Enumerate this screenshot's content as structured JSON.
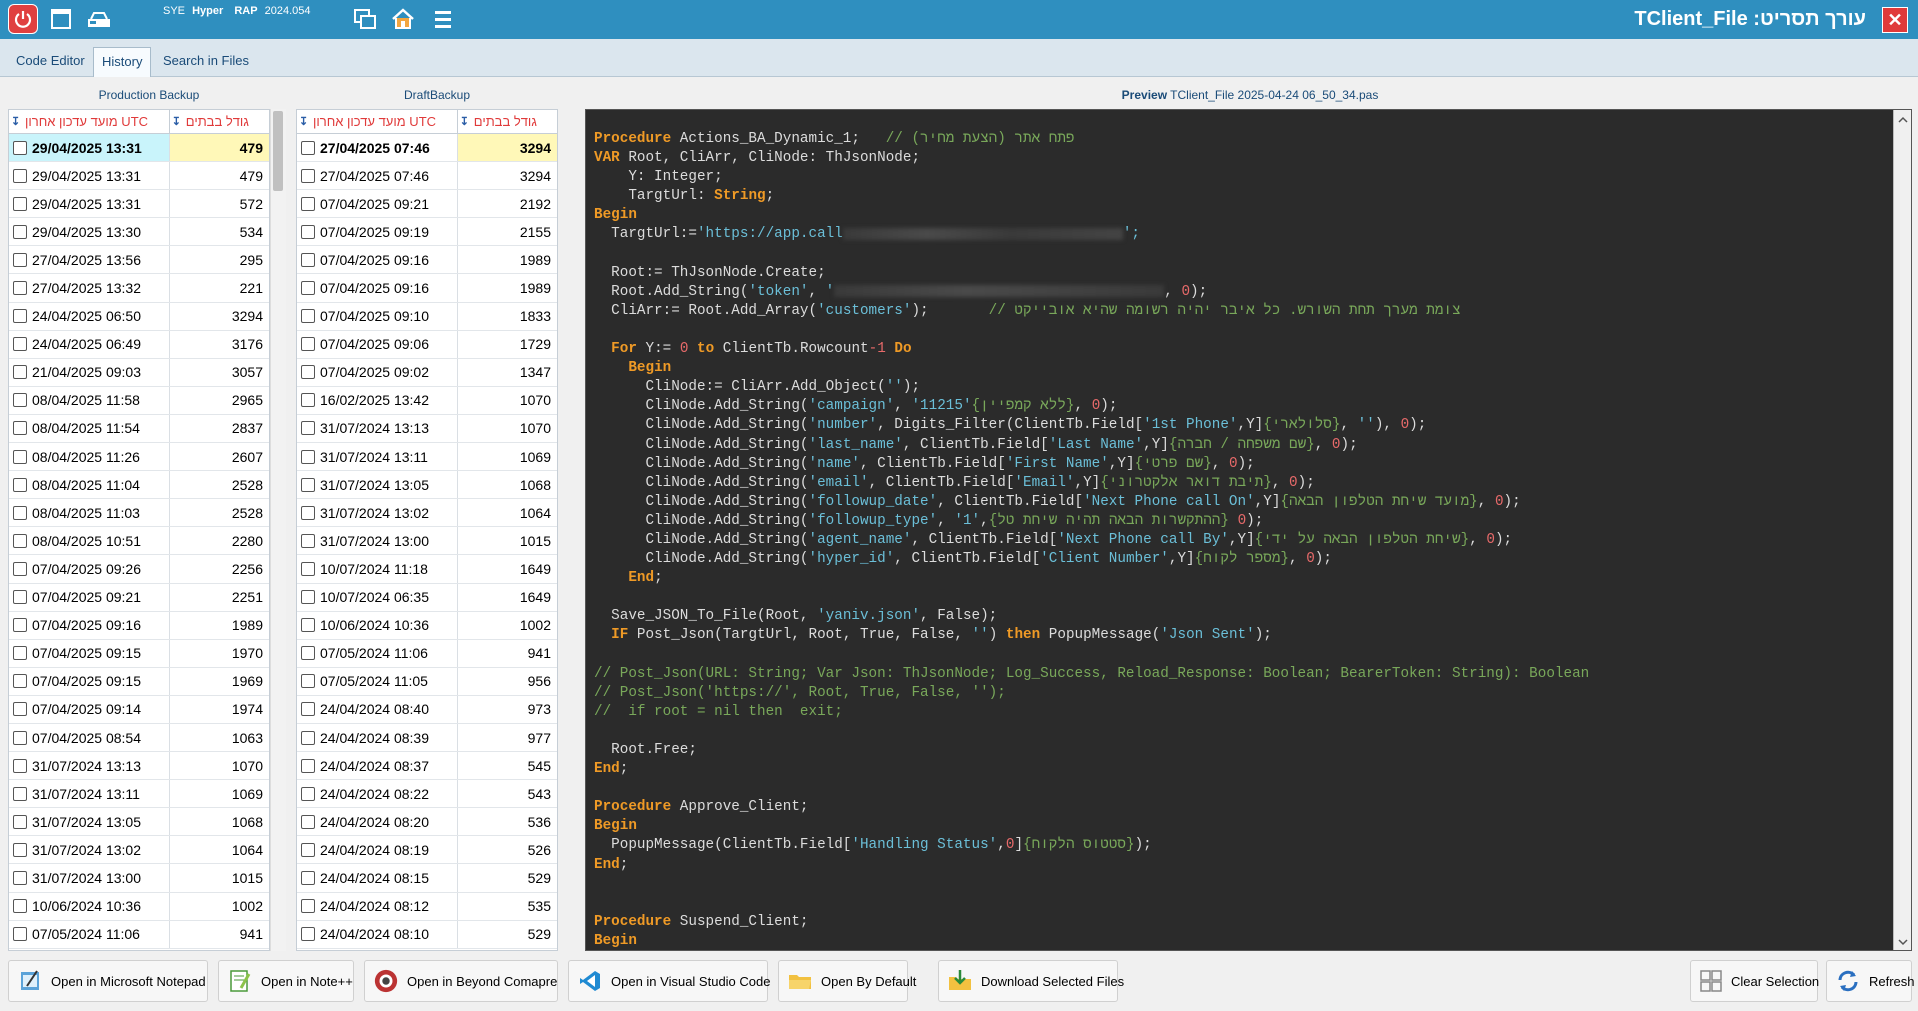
{
  "titlebar": {
    "brand1": "SYE",
    "brand2": "Hyper",
    "brand3": "RAP",
    "version": "2024.054",
    "title": "עורך תסריט: TClient_File",
    "close": "✕"
  },
  "tabs": [
    {
      "label": "Code Editor"
    },
    {
      "label": "History"
    },
    {
      "label": "Search in Files"
    }
  ],
  "production": {
    "header": "Production Backup",
    "col_date": "מועד עדכון אחרון UTC",
    "col_size": "גודל בבתים",
    "rows": [
      {
        "date": "29/04/2025 13:31",
        "size": "479"
      },
      {
        "date": "29/04/2025 13:31",
        "size": "479"
      },
      {
        "date": "29/04/2025 13:31",
        "size": "572"
      },
      {
        "date": "29/04/2025 13:30",
        "size": "534"
      },
      {
        "date": "27/04/2025 13:56",
        "size": "295"
      },
      {
        "date": "27/04/2025 13:32",
        "size": "221"
      },
      {
        "date": "24/04/2025 06:50",
        "size": "3294"
      },
      {
        "date": "24/04/2025 06:49",
        "size": "3176"
      },
      {
        "date": "21/04/2025 09:03",
        "size": "3057"
      },
      {
        "date": "08/04/2025 11:58",
        "size": "2965"
      },
      {
        "date": "08/04/2025 11:54",
        "size": "2837"
      },
      {
        "date": "08/04/2025 11:26",
        "size": "2607"
      },
      {
        "date": "08/04/2025 11:04",
        "size": "2528"
      },
      {
        "date": "08/04/2025 11:03",
        "size": "2528"
      },
      {
        "date": "08/04/2025 10:51",
        "size": "2280"
      },
      {
        "date": "07/04/2025 09:26",
        "size": "2256"
      },
      {
        "date": "07/04/2025 09:21",
        "size": "2251"
      },
      {
        "date": "07/04/2025 09:16",
        "size": "1989"
      },
      {
        "date": "07/04/2025 09:15",
        "size": "1970"
      },
      {
        "date": "07/04/2025 09:15",
        "size": "1969"
      },
      {
        "date": "07/04/2025 09:14",
        "size": "1974"
      },
      {
        "date": "07/04/2025 08:54",
        "size": "1063"
      },
      {
        "date": "31/07/2024 13:13",
        "size": "1070"
      },
      {
        "date": "31/07/2024 13:11",
        "size": "1069"
      },
      {
        "date": "31/07/2024 13:05",
        "size": "1068"
      },
      {
        "date": "31/07/2024 13:02",
        "size": "1064"
      },
      {
        "date": "31/07/2024 13:00",
        "size": "1015"
      },
      {
        "date": "10/06/2024 10:36",
        "size": "1002"
      },
      {
        "date": "07/05/2024 11:06",
        "size": "941"
      }
    ]
  },
  "draft": {
    "header": "DraftBackup",
    "col_date": "מועד עדכון אחרון UTC",
    "col_size": "גודל בבתים",
    "rows": [
      {
        "date": "27/04/2025 07:46",
        "size": "3294"
      },
      {
        "date": "27/04/2025 07:46",
        "size": "3294"
      },
      {
        "date": "07/04/2025 09:21",
        "size": "2192"
      },
      {
        "date": "07/04/2025 09:19",
        "size": "2155"
      },
      {
        "date": "07/04/2025 09:16",
        "size": "1989"
      },
      {
        "date": "07/04/2025 09:16",
        "size": "1989"
      },
      {
        "date": "07/04/2025 09:10",
        "size": "1833"
      },
      {
        "date": "07/04/2025 09:06",
        "size": "1729"
      },
      {
        "date": "07/04/2025 09:02",
        "size": "1347"
      },
      {
        "date": "16/02/2025 13:42",
        "size": "1070"
      },
      {
        "date": "31/07/2024 13:13",
        "size": "1070"
      },
      {
        "date": "31/07/2024 13:11",
        "size": "1069"
      },
      {
        "date": "31/07/2024 13:05",
        "size": "1068"
      },
      {
        "date": "31/07/2024 13:02",
        "size": "1064"
      },
      {
        "date": "31/07/2024 13:00",
        "size": "1015"
      },
      {
        "date": "10/07/2024 11:18",
        "size": "1649"
      },
      {
        "date": "10/07/2024 06:35",
        "size": "1649"
      },
      {
        "date": "10/06/2024 10:36",
        "size": "1002"
      },
      {
        "date": "07/05/2024 11:06",
        "size": "941"
      },
      {
        "date": "07/05/2024 11:05",
        "size": "956"
      },
      {
        "date": "24/04/2024 08:40",
        "size": "973"
      },
      {
        "date": "24/04/2024 08:39",
        "size": "977"
      },
      {
        "date": "24/04/2024 08:37",
        "size": "545"
      },
      {
        "date": "24/04/2024 08:22",
        "size": "543"
      },
      {
        "date": "24/04/2024 08:20",
        "size": "536"
      },
      {
        "date": "24/04/2024 08:19",
        "size": "526"
      },
      {
        "date": "24/04/2024 08:15",
        "size": "529"
      },
      {
        "date": "24/04/2024 08:12",
        "size": "535"
      },
      {
        "date": "24/04/2024 08:10",
        "size": "529"
      }
    ]
  },
  "preview": {
    "label": "Preview",
    "filename": "TClient_File 2025-04-24 06_50_34.pas"
  },
  "code": {
    "l1_kw": "Procedure",
    "l1_name": " Actions_BA_Dynamic_1;",
    "l1_cm": "   // (הצעת מחיר) פתח אתר",
    "l2_kw": "VAR",
    "l2_rest": " Root, CliArr, CliNode: ThJsonNode;",
    "l3": "    Y: Integer;",
    "l4_a": "    TargtUrl: ",
    "l4_kw": "String",
    "l4_b": ";",
    "l5_kw": "Begin",
    "l6_a": "  TargtUrl:=",
    "l6_str": "'https://app.call",
    "l6_end": "';",
    "l8": "  Root:= ThJsonNode.Create;",
    "l9_a": "  Root.Add_String(",
    "l9_str": "'token'",
    "l9_b": ", ",
    "l9_str2": "'",
    "l9_c": ", ",
    "l9_num": "0",
    "l9_d": ");",
    "l10_a": "  CliArr:= Root.Add_Array(",
    "l10_str": "'customers'",
    "l10_b": ");",
    "l10_cm": "       // צומת מערך תחת השורש. כל איבר יהיה רשומה שהיא אובייקט",
    "l12_kw1": "For",
    "l12_a": " Y:= ",
    "l12_num": "0",
    "l12_kw2": " to",
    "l12_b": " ClientTb.Rowcount",
    "l12_num2": "-1",
    "l12_kw3": " Do",
    "l13_kw": "Begin",
    "l14_a": "      CliNode:= CliArr.Add_Object(",
    "l14_str": "''",
    "l14_b": ");",
    "l15_a": "      CliNode.Add_String(",
    "l15_s1": "'campaign'",
    "l15_b": ", ",
    "l15_s2": "'11215'",
    "l15_cm": "{ללא קמפיין}",
    "l15_c": ", ",
    "l15_n": "0",
    "l15_d": ");",
    "l16_a": "      CliNode.Add_String(",
    "l16_s1": "'number'",
    "l16_b": ", Digits_Filter(ClientTb.Field[",
    "l16_s2": "'1st Phone'",
    "l16_c": ",Y]",
    "l16_cm": "{סלולארי}",
    "l16_d": ", ",
    "l16_s3": "''",
    "l16_e": "), ",
    "l16_n": "0",
    "l16_f": ");",
    "l17_a": "      CliNode.Add_String(",
    "l17_s1": "'last_name'",
    "l17_b": ", ClientTb.Field[",
    "l17_s2": "'Last Name'",
    "l17_c": ",Y]",
    "l17_cm": "{שם משפחה / חברה}",
    "l17_d": ", ",
    "l17_n": "0",
    "l17_e": ");",
    "l18_a": "      CliNode.Add_String(",
    "l18_s1": "'name'",
    "l18_b": ", ClientTb.Field[",
    "l18_s2": "'First Name'",
    "l18_c": ",Y]",
    "l18_cm": "{שם פרטי}",
    "l18_d": ", ",
    "l18_n": "0",
    "l18_e": ");",
    "l19_a": "      CliNode.Add_String(",
    "l19_s1": "'email'",
    "l19_b": ", ClientTb.Field[",
    "l19_s2": "'Email'",
    "l19_c": ",Y]",
    "l19_cm": "{תיבת דואר אלקטרוני}",
    "l19_d": ", ",
    "l19_n": "0",
    "l19_e": ");",
    "l20_a": "      CliNode.Add_String(",
    "l20_s1": "'followup_date'",
    "l20_b": ", ClientTb.Field[",
    "l20_s2": "'Next Phone call On'",
    "l20_c": ",Y]",
    "l20_cm": "{מועד שיחת הטלפון הבאה}",
    "l20_d": ", ",
    "l20_n": "0",
    "l20_e": ");",
    "l21_a": "      CliNode.Add_String(",
    "l21_s1": "'followup_type'",
    "l21_b": ", ",
    "l21_s2": "'1'",
    "l21_c": ",",
    "l21_cm": "{ההתקשרות הבאה תהיה שיחת טל}",
    "l21_d": " ",
    "l21_n": "0",
    "l21_e": ");",
    "l22_a": "      CliNode.Add_String(",
    "l22_s1": "'agent_name'",
    "l22_b": ", ClientTb.Field[",
    "l22_s2": "'Next Phone call By'",
    "l22_c": ",Y]",
    "l22_cm": "{שיחת הטלפון הבאה על ידי}",
    "l22_d": ", ",
    "l22_n": "0",
    "l22_e": ");",
    "l23_a": "      CliNode.Add_String(",
    "l23_s1": "'hyper_id'",
    "l23_b": ", ClientTb.Field[",
    "l23_s2": "'Client Number'",
    "l23_c": ",Y]",
    "l23_cm": "{מספר לקוח}",
    "l23_d": ", ",
    "l23_n": "0",
    "l23_e": ");",
    "l24_kw": "End",
    "l26_a": "  Save_JSON_To_File(Root, ",
    "l26_s": "'yaniv.json'",
    "l26_b": ", False);",
    "l27_kw": "IF",
    "l27_a": " Post_Json(TargtUrl, Root, True, False, ",
    "l27_s1": "''",
    "l27_b": ") ",
    "l27_kw2": "then",
    "l27_c": " PopupMessage(",
    "l27_s2": "'Json Sent'",
    "l27_d": ");",
    "l29": "// Post_Json(URL: String; Var Json: ThJsonNode; Log_Success, Reload_Response: Boolean; BearerToken: String): Boolean",
    "l30": "// Post_Json('https://', Root, True, False, '');",
    "l31": "//  if root = nil then  exit;",
    "l33": "  Root.Free;",
    "l34_kw": "End",
    "l36_kw": "Procedure",
    "l36_name": " Approve_Client;",
    "l37_kw": "Begin",
    "l38_a": "  PopupMessage(ClientTb.Field[",
    "l38_s": "'Handling Status'",
    "l38_b": ",",
    "l38_n": "0",
    "l38_c": "]",
    "l38_cm": "{סטטוס הלקוח}",
    "l38_d": ");",
    "l39_kw": "End",
    "l42_kw": "Procedure",
    "l42_name": " Suspend_Client;",
    "l43_kw": "Begin"
  },
  "bottom": {
    "notepad": "Open in Microsoft Notepad",
    "notepp": "Open in Note++",
    "beyond": "Open in Beyond Comapre",
    "vscode": "Open in Visual Studio Code",
    "default": "Open By Default",
    "download": "Download Selected Files",
    "clear": "Clear Selection",
    "refresh": "Refresh"
  }
}
